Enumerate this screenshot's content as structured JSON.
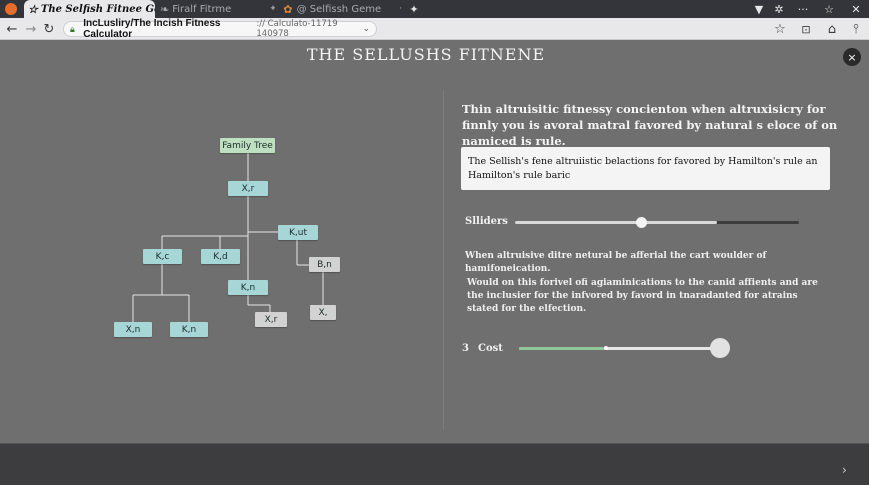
{
  "browser": {
    "tabs": [
      {
        "label": "The Selfish Fitnee Gene",
        "icon": "star-icon",
        "active": true
      },
      {
        "label": "Firalf Fitrme",
        "icon": "pin-icon",
        "active": false
      },
      {
        "label": "@ Selfissh Geme",
        "icon": "gene-icon",
        "active": false
      }
    ],
    "url_host": "IncLusliry/The Incish Fitness Calculator",
    "url_path": ":// Calculato-11719 140978"
  },
  "page": {
    "title": "THE SELLUSHS  FITNENE",
    "close_label": "×"
  },
  "tree": {
    "nodes": [
      {
        "id": "root",
        "label": "Family Tree",
        "style": "root"
      },
      {
        "id": "xr1",
        "label": "X,r",
        "style": "teal"
      },
      {
        "id": "kut",
        "label": "K,ut",
        "style": "teal"
      },
      {
        "id": "kc",
        "label": "K,c",
        "style": "teal"
      },
      {
        "id": "kd",
        "label": "K,d",
        "style": "teal"
      },
      {
        "id": "bn",
        "label": "B,n",
        "style": "grey"
      },
      {
        "id": "kn1",
        "label": "K,n",
        "style": "teal"
      },
      {
        "id": "xr2",
        "label": "X,r",
        "style": "grey"
      },
      {
        "id": "xi",
        "label": "X,",
        "style": "grey"
      },
      {
        "id": "xn",
        "label": "X,n",
        "style": "teal"
      },
      {
        "id": "kn2",
        "label": "K,n",
        "style": "teal"
      }
    ]
  },
  "panel": {
    "heading": "Thin altruisitic fitnessy concienton when altruxisicry for finnly you is avoral matral favored by natural s eloce of on namiced is rule.",
    "callout": "The Sellish's fene altruiistic belactions for favored by Hamilton's rule an Hamilton's rule baric",
    "sliders_label": "Slliders",
    "sliders_value": 0.45,
    "sentence1": "When altruisive ditre netural be afferial the cart woulder of hamifoneication.",
    "sentence2": "Would on this forivel ofi agiaminications to the canid affients and are the inclusier for the  infvored by favord in tnaradanted for atrains stated for the elfection.",
    "cost_number": "3",
    "cost_label": "Cost",
    "cost_value": 0.95
  },
  "colors": {
    "slider_fill_dark": "#2f2f2f",
    "cost_fill": "#8fc79a",
    "node_root": "#bfe0c0",
    "node_teal": "#a6d6d6",
    "node_grey": "#d2d2d2"
  }
}
